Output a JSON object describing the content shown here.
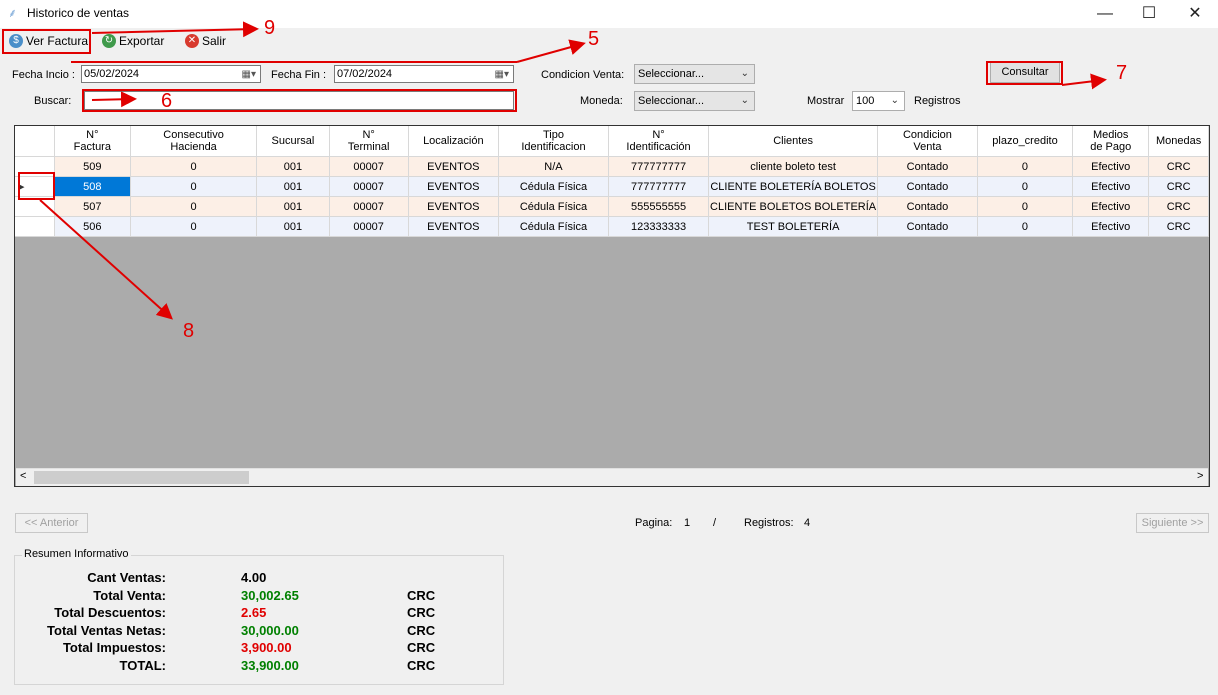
{
  "window": {
    "title": "Historico de ventas",
    "minimize": "—",
    "maximize": "☐",
    "close": "✕"
  },
  "toolbar": {
    "ver_factura": "Ver Factura",
    "exportar": "Exportar",
    "salir": "Salir"
  },
  "filters": {
    "fecha_inicio_label": "Fecha Incio :",
    "fecha_inicio_value": "05/02/2024",
    "fecha_fin_label": "Fecha Fin :",
    "fecha_fin_value": "07/02/2024",
    "condicion_label": "Condicion Venta:",
    "condicion_value": "Seleccionar...",
    "moneda_label": "Moneda:",
    "moneda_value": "Seleccionar...",
    "buscar_label": "Buscar:",
    "buscar_value": "",
    "mostrar_label": "Mostrar",
    "mostrar_value": "100",
    "registros_label": "Registros",
    "consultar": "Consultar"
  },
  "grid": {
    "columns": [
      {
        "l1": "N°",
        "l2": "Factura"
      },
      {
        "l1": "Consecutivo",
        "l2": "Hacienda"
      },
      {
        "l1": "Sucursal",
        "l2": ""
      },
      {
        "l1": "N°",
        "l2": "Terminal"
      },
      {
        "l1": "Localización",
        "l2": ""
      },
      {
        "l1": "Tipo",
        "l2": "Identificacion"
      },
      {
        "l1": "N°",
        "l2": "Identificación"
      },
      {
        "l1": "Clientes",
        "l2": ""
      },
      {
        "l1": "Condicion",
        "l2": "Venta"
      },
      {
        "l1": "plazo_credito",
        "l2": ""
      },
      {
        "l1": "Medios",
        "l2": "de Pago"
      },
      {
        "l1": "Monedas",
        "l2": ""
      }
    ],
    "rows": [
      [
        "509",
        "0",
        "001",
        "00007",
        "EVENTOS",
        "N/A",
        "777777777",
        "cliente boleto test",
        "Contado",
        "0",
        "Efectivo",
        "CRC"
      ],
      [
        "508",
        "0",
        "001",
        "00007",
        "EVENTOS",
        "Cédula Física",
        "777777777",
        "CLIENTE BOLETERÍA BOLETOS",
        "Contado",
        "0",
        "Efectivo",
        "CRC"
      ],
      [
        "507",
        "0",
        "001",
        "00007",
        "EVENTOS",
        "Cédula Física",
        "555555555",
        "CLIENTE BOLETOS BOLETERÍA",
        "Contado",
        "0",
        "Efectivo",
        "CRC"
      ],
      [
        "506",
        "0",
        "001",
        "00007",
        "EVENTOS",
        "Cédula Física",
        "123333333",
        "TEST BOLETERÍA",
        "Contado",
        "0",
        "Efectivo",
        "CRC"
      ]
    ],
    "scroll_left": "<",
    "scroll_right": ">"
  },
  "pagination": {
    "anterior": "<< Anterior",
    "siguiente": "Siguiente >>",
    "pagina_label": "Pagina:",
    "pagina_value": "1",
    "slash": "/",
    "registros_label": "Registros:",
    "registros_value": "4"
  },
  "summary": {
    "legend": "Resumen Informativo",
    "rows": [
      {
        "label": "Cant Ventas:",
        "value": "4.00",
        "currency": "",
        "color": "#000000"
      },
      {
        "label": "Total Venta:",
        "value": "30,002.65",
        "currency": "CRC",
        "color": "#008000"
      },
      {
        "label": "Total Descuentos:",
        "value": "2.65",
        "currency": "CRC",
        "color": "#e00000"
      },
      {
        "label": "Total Ventas Netas:",
        "value": "30,000.00",
        "currency": "CRC",
        "color": "#008000"
      },
      {
        "label": "Total Impuestos:",
        "value": "3,900.00",
        "currency": "CRC",
        "color": "#e00000"
      },
      {
        "label": "TOTAL:",
        "value": "33,900.00",
        "currency": "CRC",
        "color": "#008000"
      }
    ]
  },
  "annotations": {
    "n5": "5",
    "n6": "6",
    "n7": "7",
    "n8": "8",
    "n9": "9",
    "color": "#e00000"
  }
}
